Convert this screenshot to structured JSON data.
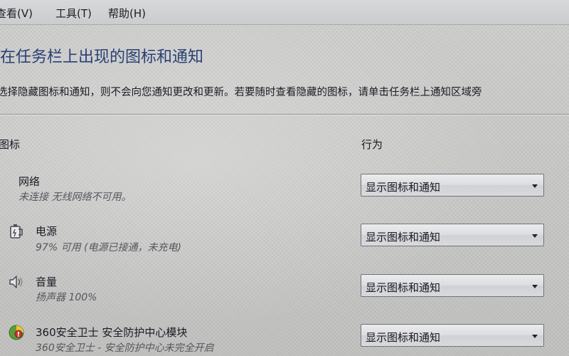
{
  "menu": {
    "view": "查看(V)",
    "tools": "工具(T)",
    "help": "帮助(H)"
  },
  "heading": "在任务栏上出现的图标和通知",
  "description": "选择隐藏图标和通知，则不会向您通知更改和更新。若要随时查看隐藏的图标，请单击任务栏上通知区域旁",
  "columns": {
    "icon": "图标",
    "behavior": "行为"
  },
  "rows": [
    {
      "title": "网络",
      "status": "未连接 无线网络不可用。",
      "behavior": "显示图标和通知",
      "icon": "network-icon"
    },
    {
      "title": "电源",
      "status": "97% 可用 (电源已接通，未充电)",
      "behavior": "显示图标和通知",
      "icon": "power-icon"
    },
    {
      "title": "音量",
      "status": "扬声器 100%",
      "behavior": "显示图标和通知",
      "icon": "speaker-icon"
    },
    {
      "title": "360安全卫士 安全防护中心模块",
      "status": "360安全卫士 - 安全防护中心未完全开启",
      "behavior": "显示图标和通知",
      "icon": "360-safe-icon"
    }
  ],
  "colors": {
    "heading": "#2a3f74",
    "background": "#c9cac8",
    "status_text": "#55575c"
  }
}
